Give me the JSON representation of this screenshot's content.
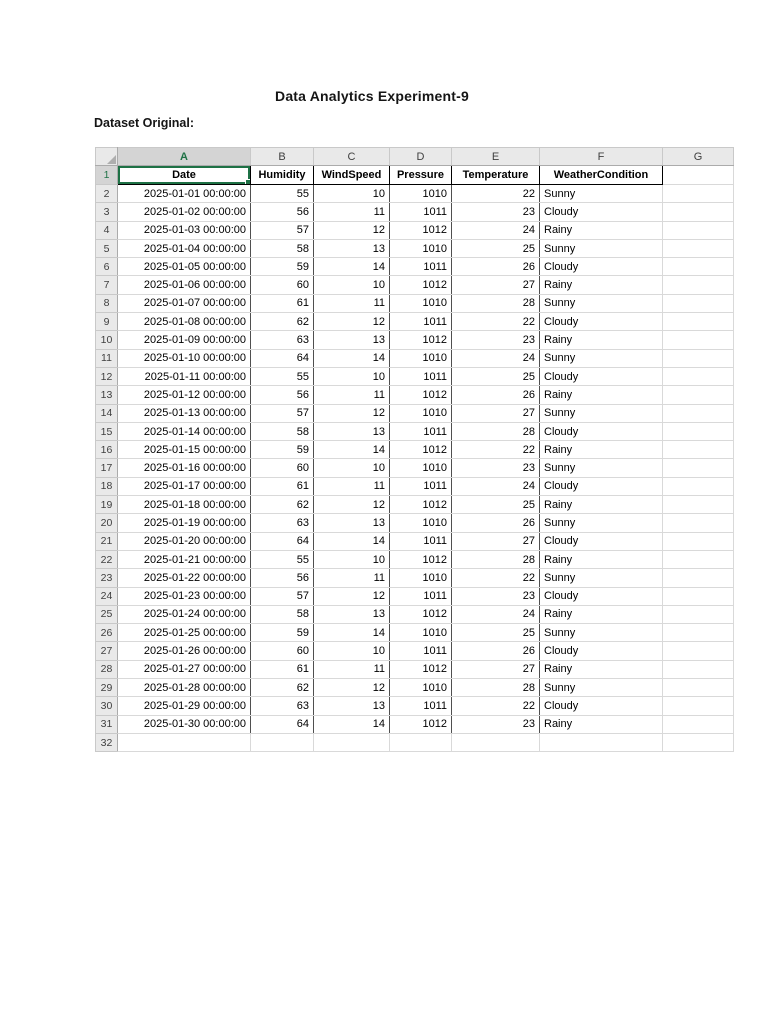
{
  "page": {
    "title": "Data Analytics Experiment-9",
    "section_label": "Dataset Original:"
  },
  "spreadsheet": {
    "selected_cell": "A1",
    "selected_column": "A",
    "selected_row_number": 1,
    "column_letters": [
      "A",
      "B",
      "C",
      "D",
      "E",
      "F",
      "G"
    ],
    "header_row": [
      "Date",
      "Humidity",
      "WindSpeed",
      "Pressure",
      "Temperature",
      "WeatherCondition"
    ],
    "first_row_number": 1,
    "last_row_number": 32,
    "data_rows": [
      [
        "2025-01-01 00:00:00",
        55,
        10,
        1010,
        22,
        "Sunny"
      ],
      [
        "2025-01-02 00:00:00",
        56,
        11,
        1011,
        23,
        "Cloudy"
      ],
      [
        "2025-01-03 00:00:00",
        57,
        12,
        1012,
        24,
        "Rainy"
      ],
      [
        "2025-01-04 00:00:00",
        58,
        13,
        1010,
        25,
        "Sunny"
      ],
      [
        "2025-01-05 00:00:00",
        59,
        14,
        1011,
        26,
        "Cloudy"
      ],
      [
        "2025-01-06 00:00:00",
        60,
        10,
        1012,
        27,
        "Rainy"
      ],
      [
        "2025-01-07 00:00:00",
        61,
        11,
        1010,
        28,
        "Sunny"
      ],
      [
        "2025-01-08 00:00:00",
        62,
        12,
        1011,
        22,
        "Cloudy"
      ],
      [
        "2025-01-09 00:00:00",
        63,
        13,
        1012,
        23,
        "Rainy"
      ],
      [
        "2025-01-10 00:00:00",
        64,
        14,
        1010,
        24,
        "Sunny"
      ],
      [
        "2025-01-11 00:00:00",
        55,
        10,
        1011,
        25,
        "Cloudy"
      ],
      [
        "2025-01-12 00:00:00",
        56,
        11,
        1012,
        26,
        "Rainy"
      ],
      [
        "2025-01-13 00:00:00",
        57,
        12,
        1010,
        27,
        "Sunny"
      ],
      [
        "2025-01-14 00:00:00",
        58,
        13,
        1011,
        28,
        "Cloudy"
      ],
      [
        "2025-01-15 00:00:00",
        59,
        14,
        1012,
        22,
        "Rainy"
      ],
      [
        "2025-01-16 00:00:00",
        60,
        10,
        1010,
        23,
        "Sunny"
      ],
      [
        "2025-01-17 00:00:00",
        61,
        11,
        1011,
        24,
        "Cloudy"
      ],
      [
        "2025-01-18 00:00:00",
        62,
        12,
        1012,
        25,
        "Rainy"
      ],
      [
        "2025-01-19 00:00:00",
        63,
        13,
        1010,
        26,
        "Sunny"
      ],
      [
        "2025-01-20 00:00:00",
        64,
        14,
        1011,
        27,
        "Cloudy"
      ],
      [
        "2025-01-21 00:00:00",
        55,
        10,
        1012,
        28,
        "Rainy"
      ],
      [
        "2025-01-22 00:00:00",
        56,
        11,
        1010,
        22,
        "Sunny"
      ],
      [
        "2025-01-23 00:00:00",
        57,
        12,
        1011,
        23,
        "Cloudy"
      ],
      [
        "2025-01-24 00:00:00",
        58,
        13,
        1012,
        24,
        "Rainy"
      ],
      [
        "2025-01-25 00:00:00",
        59,
        14,
        1010,
        25,
        "Sunny"
      ],
      [
        "2025-01-26 00:00:00",
        60,
        10,
        1011,
        26,
        "Cloudy"
      ],
      [
        "2025-01-27 00:00:00",
        61,
        11,
        1012,
        27,
        "Rainy"
      ],
      [
        "2025-01-28 00:00:00",
        62,
        12,
        1010,
        28,
        "Sunny"
      ],
      [
        "2025-01-29 00:00:00",
        63,
        13,
        1011,
        22,
        "Cloudy"
      ],
      [
        "2025-01-30 00:00:00",
        64,
        14,
        1012,
        23,
        "Rainy"
      ]
    ],
    "colors": {
      "selection_green": "#1E7145",
      "selected_header_text_green": "#1F7246",
      "header_fill": "#E9E9E9",
      "selected_header_fill": "#D4D4D4",
      "gridline": "#D9D9D9",
      "column_divider": "#4F4F4F"
    }
  }
}
